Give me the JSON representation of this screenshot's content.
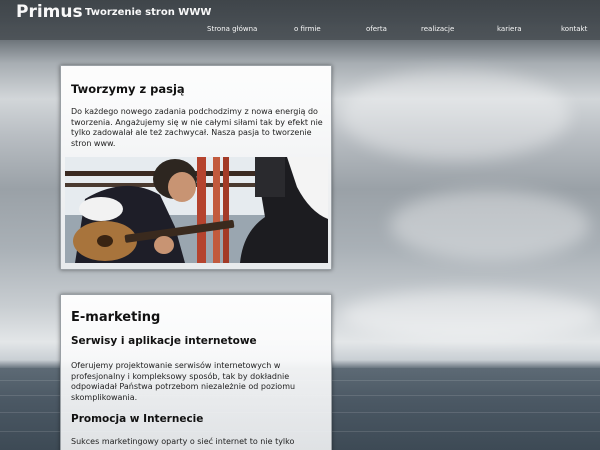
{
  "header": {
    "brand": "Primus",
    "tagline": "Tworzenie stron WWW",
    "nav": [
      {
        "label": "Strona główna"
      },
      {
        "label": "o firmie"
      },
      {
        "label": "oferta"
      },
      {
        "label": "realizacje"
      },
      {
        "label": "kariera"
      },
      {
        "label": "kontakt"
      }
    ]
  },
  "card1": {
    "title": "Tworzymy z pasją",
    "text": "Do każdego nowego zadania podchodzimy z nowa energią do tworzenia. Angażujemy się w nie całymi siłami tak by efekt nie tylko zadowalał ale też zachwycał. Nasza pasja to tworzenie stron www."
  },
  "card2": {
    "title": "E-marketing",
    "subtitle1": "Serwisy i aplikacje internetowe",
    "text1": "Oferujemy projektowanie serwisów internetowych w profesjonalny i kompleksowy sposób, tak by dokładnie odpowiadał Państwa potrzebom niezależnie od poziomu skomplikowania.",
    "subtitle2": "Promocja w Internecie",
    "text2": "Sukces marketingowy oparty o sieć internet to nie tylko"
  }
}
